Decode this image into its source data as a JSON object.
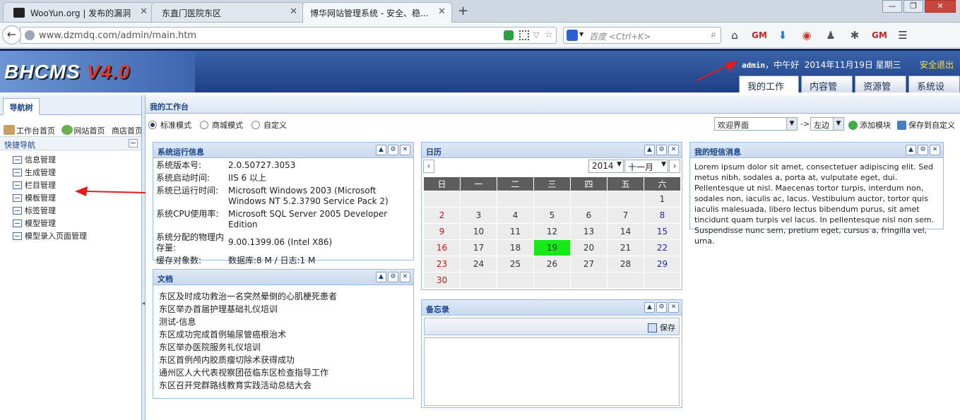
{
  "browser": {
    "tabs": [
      {
        "title": "WooYun.org | 发布的漏洞",
        "active": false
      },
      {
        "title": "东直门医院东区",
        "active": false
      },
      {
        "title": "博华网站管理系统 - 安全、稳...",
        "active": true
      }
    ],
    "url": "www.dzmdq.com/admin/main.htm",
    "search_placeholder": "百度 <Ctrl+K>"
  },
  "header": {
    "logo": "BHCMS",
    "logo_version": "V4.0",
    "greeting_user": "admin",
    "greeting_text": "，中午好",
    "date": "2014年11月19日 星期三",
    "logout": "安全退出",
    "nav": [
      {
        "label": "我的工作台",
        "active": true
      },
      {
        "label": "内容管理",
        "active": false
      },
      {
        "label": "资源管理",
        "active": false
      },
      {
        "label": "系统设置",
        "active": false
      }
    ]
  },
  "sidebar": {
    "tab": "导航树",
    "quick_links": [
      "工作台首页",
      "网站首页",
      "商店首页"
    ],
    "section_title": "快捷导航",
    "items": [
      "信息管理",
      "生成管理",
      "栏目管理",
      "模板管理",
      "标签管理",
      "模型管理",
      "模型录入页面管理"
    ]
  },
  "main": {
    "title": "我的工作台",
    "modes": [
      {
        "label": "标准模式",
        "selected": true
      },
      {
        "label": "商城模式",
        "selected": false
      },
      {
        "label": "自定义",
        "selected": false
      }
    ],
    "module_select": "欢迎界面",
    "arrow": "->",
    "position_select": "左边",
    "add_module": "添加模块",
    "save_custom": "保存到自定义"
  },
  "sysinfo": {
    "title": "系统运行信息",
    "rows": [
      {
        "k": "系统版本号:",
        "v": "2.0.50727.3053"
      },
      {
        "k": "系统启动时间:",
        "v": "IIS 6 以上"
      },
      {
        "k": "系统已运行时间:",
        "v": "Microsoft Windows 2003 (Microsoft Windows NT 5.2.3790 Service Pack 2)"
      },
      {
        "k": "系统CPU使用率:",
        "v": "Microsoft SQL Server 2005 Developer Edition"
      },
      {
        "k": "系统分配的物理内存量:",
        "v": "9.00.1399.06 (Intel X86)"
      },
      {
        "k": "缓存对象数:",
        "v": "数据库:8 M / 日志:1 M"
      }
    ]
  },
  "docs": {
    "title": "文档",
    "items": [
      "东区及时成功救治一名突然晕倒的心肌梗死患者",
      "东区举办首届护理基础礼仪培训",
      "测试-信息",
      "东区成功完成首例输尿管癌根治术",
      "东区举办医院服务礼仪培训",
      "东区首例颅内胶质瘤切除术获得成功",
      "通州区人大代表视察团莅临东区检查指导工作",
      "东区召开党群路线教育实践活动总结大会"
    ]
  },
  "calendar": {
    "title": "日历",
    "year": "2014",
    "month": "十一月",
    "weekdays": [
      "日",
      "一",
      "二",
      "三",
      "四",
      "五",
      "六"
    ],
    "weeks": [
      [
        "",
        "",
        "",
        "",
        "",
        "",
        "1"
      ],
      [
        "2",
        "3",
        "4",
        "5",
        "6",
        "7",
        "8"
      ],
      [
        "9",
        "10",
        "11",
        "12",
        "13",
        "14",
        "15"
      ],
      [
        "16",
        "17",
        "18",
        "19",
        "20",
        "21",
        "22"
      ],
      [
        "23",
        "24",
        "25",
        "26",
        "27",
        "28",
        "29"
      ],
      [
        "30",
        "",
        "",
        "",
        "",
        "",
        ""
      ]
    ],
    "today": "19",
    "colors": {
      "today": "#18e818",
      "sunday": "#d01010",
      "saturday": "#1a2ab0",
      "header": "#5d5d5d"
    }
  },
  "memo": {
    "title": "备忘录",
    "save": "保存"
  },
  "sms": {
    "title": "我的短信消息",
    "body": "Lorem ipsum dolor sit amet, consectetuer adipiscing elit. Sed metus nibh, sodales a, porta at, vulputate eget, dui. Pellentesque ut nisl. Maecenas tortor turpis, interdum non, sodales non, iaculis ac, lacus. Vestibulum auctor, tortor quis iaculis malesuada, libero lectus bibendum purus, sit amet tincidunt quam turpis vel lacus. In pellentesque nisl non sem. Suspendisse nunc sem, pretium eget, cursus a, fringilla vel, urna."
  },
  "portlet_buttons": [
    "collapse-icon",
    "settings-icon",
    "close-icon"
  ]
}
